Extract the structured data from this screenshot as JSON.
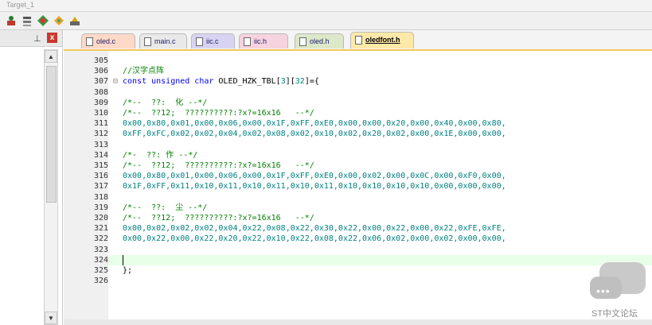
{
  "window": {
    "top_toolbar_fragment": "Target_1"
  },
  "tabs": [
    {
      "label": "oled.c",
      "active": false,
      "bg": "#ffd9c8"
    },
    {
      "label": "main.c",
      "active": false,
      "bg": "#e9e9e9"
    },
    {
      "label": "iic.c",
      "active": false,
      "bg": "#d9d3f3"
    },
    {
      "label": "iic.h",
      "active": false,
      "bg": "#f6d3de"
    },
    {
      "label": "oled.h",
      "active": false,
      "bg": "#dde8c9"
    },
    {
      "label": "oledfont.h",
      "active": true,
      "bg": "#ffe9a8"
    }
  ],
  "code_lines": [
    {
      "n": "305",
      "fold": "",
      "parts": [],
      "current": false
    },
    {
      "n": "306",
      "fold": "",
      "parts": [
        {
          "t": "//汉字点阵",
          "c": "cm"
        }
      ],
      "current": false
    },
    {
      "n": "307",
      "fold": "⊟",
      "parts": [
        {
          "t": "const unsigned char",
          "c": "kw"
        },
        {
          "t": " OLED_HZK_TBL[",
          "c": "plain"
        },
        {
          "t": "3",
          "c": "num"
        },
        {
          "t": "][",
          "c": "plain"
        },
        {
          "t": "32",
          "c": "num"
        },
        {
          "t": "]={",
          "c": "plain"
        }
      ],
      "current": false
    },
    {
      "n": "308",
      "fold": "",
      "parts": [],
      "current": false
    },
    {
      "n": "309",
      "fold": "",
      "parts": [
        {
          "t": "/*--  ??:  化 --*/",
          "c": "cm"
        }
      ],
      "current": false
    },
    {
      "n": "310",
      "fold": "",
      "parts": [
        {
          "t": "/*--  ??12;  ??????????:?x?=16x16   --*/",
          "c": "cm"
        }
      ],
      "current": false
    },
    {
      "n": "311",
      "fold": "",
      "parts": [
        {
          "t": "0x00,0x80,0x01,0x00,0x06,0x00,0x1F,0xFF,0xE0,0x00,0x00,0x20,0x00,0x40,0x00,0x80,",
          "c": "num"
        }
      ],
      "current": false
    },
    {
      "n": "312",
      "fold": "",
      "parts": [
        {
          "t": "0xFF,0xFC,0x02,0x02,0x04,0x02,0x08,0x02,0x10,0x02,0x20,0x02,0x00,0x1E,0x00,0x00,",
          "c": "num"
        }
      ],
      "current": false
    },
    {
      "n": "313",
      "fold": "",
      "parts": [],
      "current": false
    },
    {
      "n": "314",
      "fold": "",
      "parts": [
        {
          "t": "/*-  ??: 作 --*/",
          "c": "cm"
        }
      ],
      "current": false
    },
    {
      "n": "315",
      "fold": "",
      "parts": [
        {
          "t": "/*--  ??12;  ??????????:?x?=16x16   --*/",
          "c": "cm"
        }
      ],
      "current": false
    },
    {
      "n": "316",
      "fold": "",
      "parts": [
        {
          "t": "0x00,0x80,0x01,0x00,0x06,0x00,0x1F,0xFF,0xE0,0x00,0x02,0x00,0x0C,0x00,0xF0,0x00,",
          "c": "num"
        }
      ],
      "current": false
    },
    {
      "n": "317",
      "fold": "",
      "parts": [
        {
          "t": "0x1F,0xFF,0x11,0x10,0x11,0x10,0x11,0x10,0x11,0x10,0x10,0x10,0x10,0x00,0x00,0x00,",
          "c": "num"
        }
      ],
      "current": false
    },
    {
      "n": "318",
      "fold": "",
      "parts": [],
      "current": false
    },
    {
      "n": "319",
      "fold": "",
      "parts": [
        {
          "t": "/*--  ??:  尘 --*/",
          "c": "cm"
        }
      ],
      "current": false
    },
    {
      "n": "320",
      "fold": "",
      "parts": [
        {
          "t": "/*--  ??12;  ??????????:?x?=16x16   --*/",
          "c": "cm"
        }
      ],
      "current": false
    },
    {
      "n": "321",
      "fold": "",
      "parts": [
        {
          "t": "0x00,0x02,0x02,0x02,0x04,0x22,0x08,0x22,0x30,0x22,0x00,0x22,0x00,0x22,0xFE,0xFE,",
          "c": "num"
        }
      ],
      "current": false
    },
    {
      "n": "322",
      "fold": "",
      "parts": [
        {
          "t": "0x00,0x22,0x00,0x22,0x20,0x22,0x10,0x22,0x08,0x22,0x06,0x02,0x00,0x02,0x00,0x00,",
          "c": "num"
        }
      ],
      "current": false
    },
    {
      "n": "323",
      "fold": "",
      "parts": [],
      "current": false
    },
    {
      "n": "324",
      "fold": "",
      "parts": [],
      "current": true
    },
    {
      "n": "325",
      "fold": "",
      "parts": [
        {
          "t": "};",
          "c": "plain"
        }
      ],
      "current": false
    },
    {
      "n": "326",
      "fold": "",
      "parts": [],
      "current": false
    }
  ],
  "watermark": {
    "text": "ST中文论坛"
  },
  "colors": {
    "keyword": "#0000ff",
    "comment": "#008000",
    "number": "#008080",
    "active_tab": "#ffe9a8",
    "current_line": "#e8ffe8"
  }
}
